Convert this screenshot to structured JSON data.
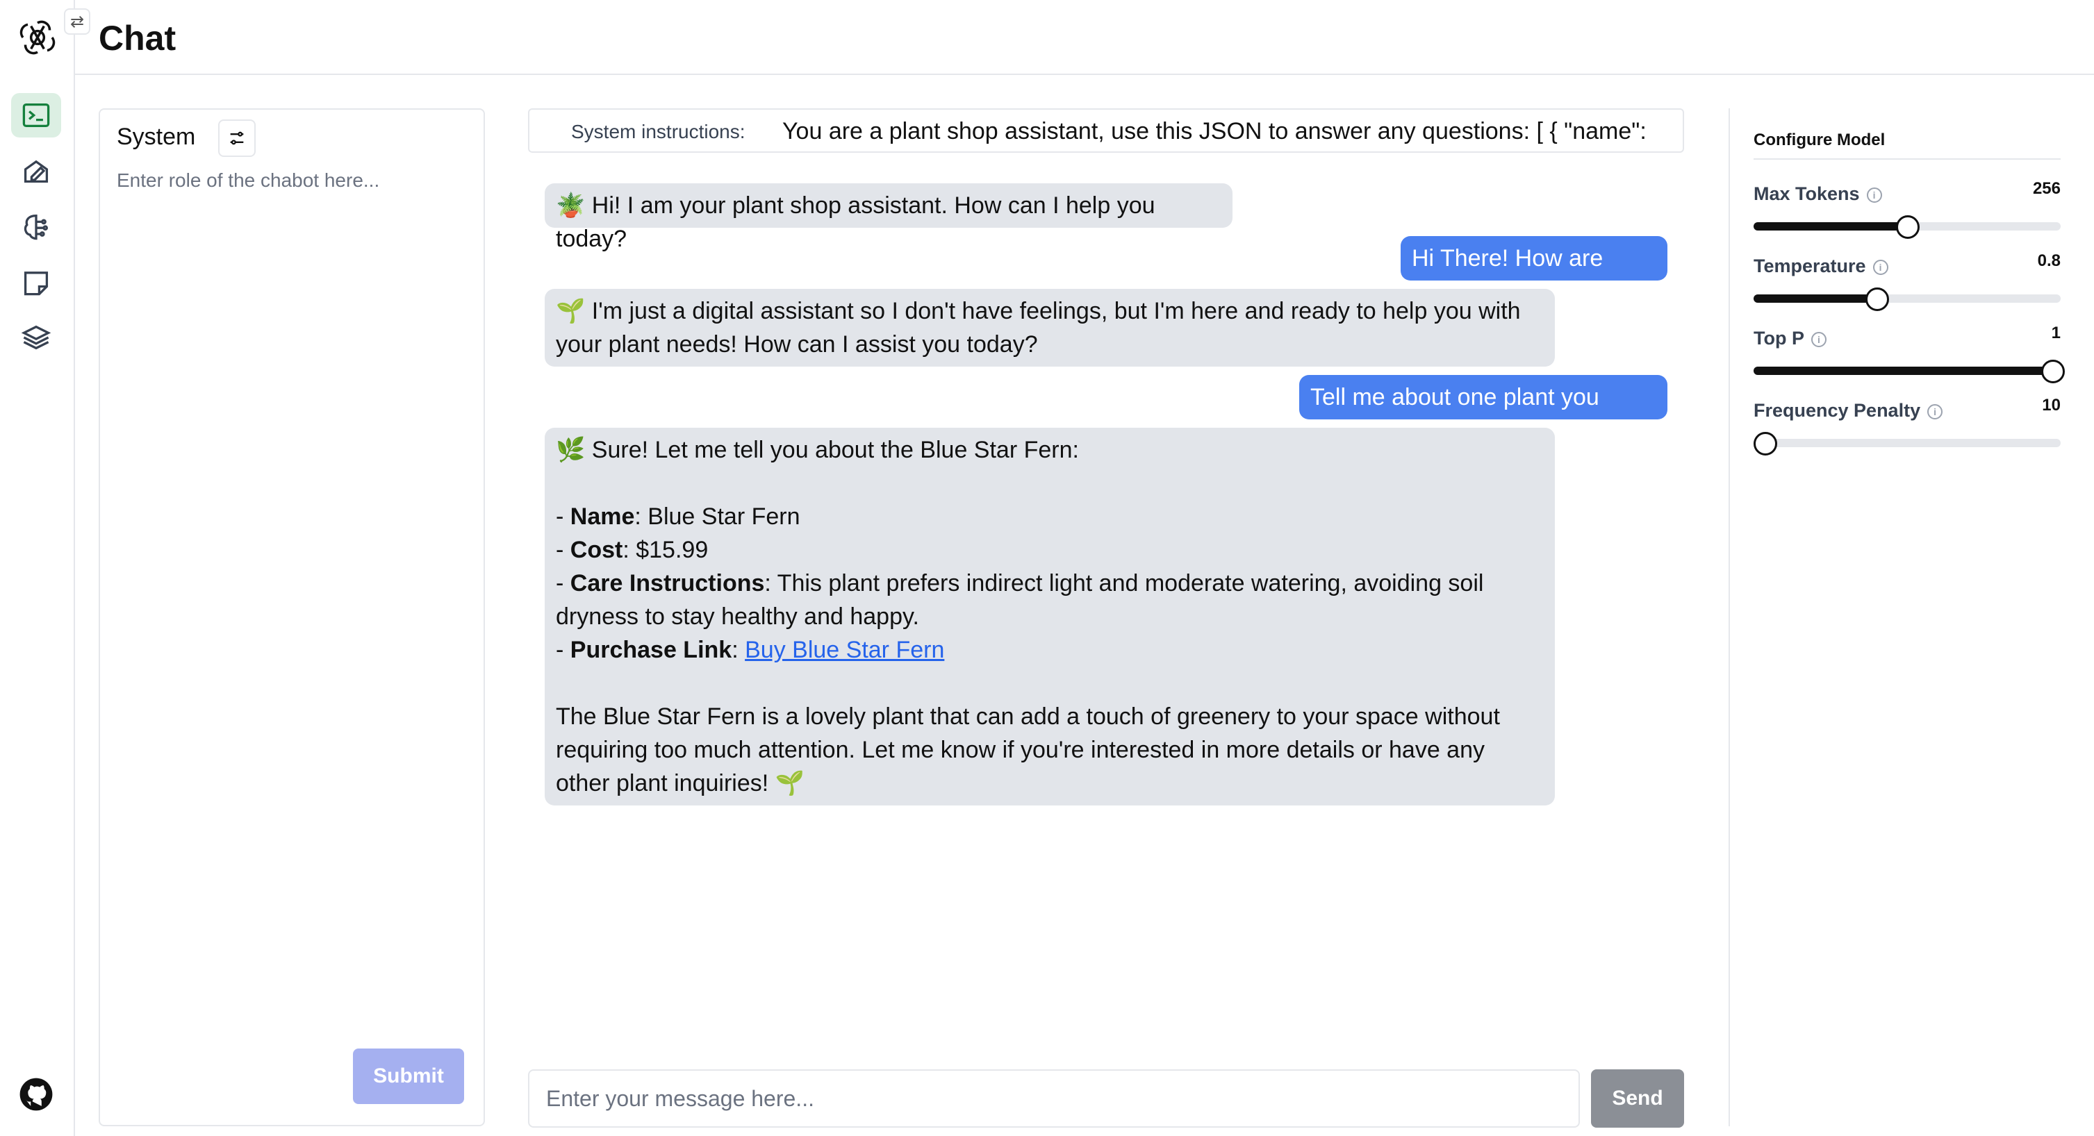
{
  "app": {
    "title": "Chat",
    "swap_icon": "arrows-swap-icon"
  },
  "rail": {
    "items": [
      {
        "name": "terminal-icon",
        "active": true
      },
      {
        "name": "pencil-square-icon",
        "active": false
      },
      {
        "name": "brain-icon",
        "active": false
      },
      {
        "name": "sticky-note-icon",
        "active": false
      },
      {
        "name": "layers-icon",
        "active": false
      }
    ],
    "footer_icon": "github-icon"
  },
  "system": {
    "title": "System",
    "settings_icon": "sliders-icon",
    "placeholder": "Enter role of the chabot here...",
    "submit_label": "Submit"
  },
  "chat": {
    "system_instructions_label": "System instructions:",
    "system_instructions_value": "You are a plant shop assistant, use this JSON to answer any questions: [ { \"name\":",
    "messages": [
      {
        "role": "assistant",
        "emoji": "🪴",
        "text": "Hi! I am your plant shop assistant. How can I help you today?"
      },
      {
        "role": "user",
        "text": "Hi There! How are you?"
      },
      {
        "role": "assistant",
        "emoji": "🌱",
        "text": "I'm just a digital assistant so I don't have feelings, but I'm here and ready to help you with your plant needs! How can I assist you today?"
      },
      {
        "role": "user",
        "text": "Tell me about one plant you have"
      },
      {
        "role": "assistant",
        "emoji": "🌿",
        "intro": "Sure! Let me tell you about the Blue Star Fern:",
        "details": [
          {
            "prefix": "- ",
            "key": "Name",
            "value": ": Blue Star Fern"
          },
          {
            "prefix": "- ",
            "key": "Cost",
            "value": ": $15.99"
          },
          {
            "prefix": "- ",
            "key": "Care Instructions",
            "value": ": This plant prefers indirect light and moderate watering, avoiding soil dryness to stay healthy and happy."
          },
          {
            "prefix": "- ",
            "key": "Purchase Link",
            "value": ": ",
            "link_text": "Buy Blue Star Fern"
          }
        ],
        "outro": "The Blue Star Fern is a lovely plant that can add a touch of greenery to your space without requiring too much attention. Let me know if you're interested in more details or have any other plant inquiries!",
        "outro_emoji": "🌱"
      }
    ],
    "input_placeholder": "Enter your message here...",
    "send_label": "Send"
  },
  "config": {
    "title": "Configure Model",
    "info_icon": "info-circle-icon",
    "params": [
      {
        "label": "Max Tokens",
        "value": "256",
        "level": 0.5
      },
      {
        "label": "Temperature",
        "value": "0.8",
        "level": 0.4
      },
      {
        "label": "Top P",
        "value": "1",
        "level": 1.0
      },
      {
        "label": "Frequency Penalty",
        "value": "10",
        "level": 0.0
      }
    ]
  }
}
